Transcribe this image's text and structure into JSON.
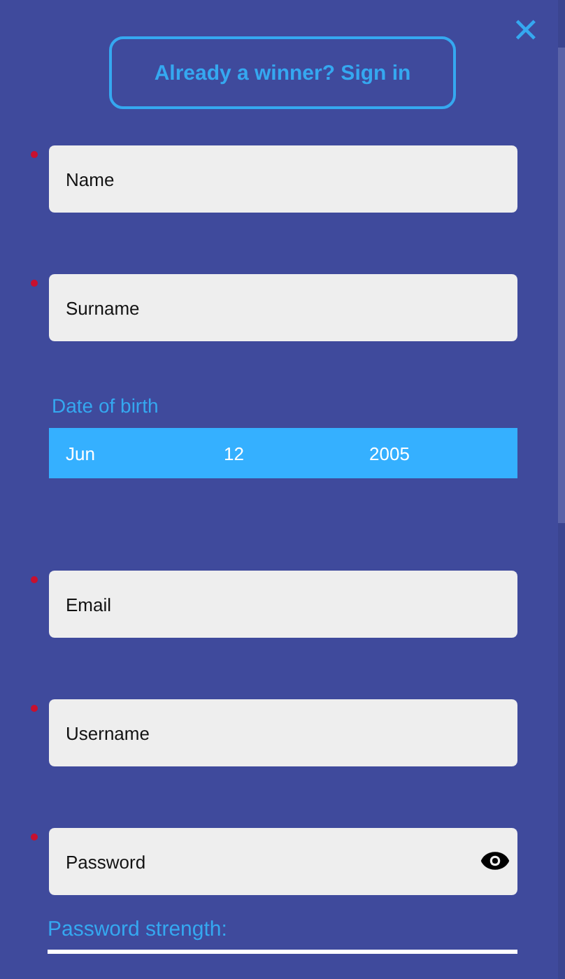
{
  "sign_in_button": "Already a winner? Sign in",
  "close_button": "✕",
  "fields": [
    {
      "kind": "text",
      "placeholder": "Name",
      "required": true
    },
    {
      "kind": "text",
      "placeholder": "Surname",
      "required": true
    },
    {
      "kind": "date",
      "label": "Date of birth",
      "parts": [
        "Jun",
        "12",
        "2005"
      ]
    },
    {
      "kind": "text",
      "placeholder": "Email",
      "required": true
    },
    {
      "kind": "text",
      "placeholder": "Username",
      "required": true
    },
    {
      "kind": "password",
      "placeholder": "Password",
      "required": true
    }
  ],
  "password_strength": {
    "label": "Password strength:"
  }
}
